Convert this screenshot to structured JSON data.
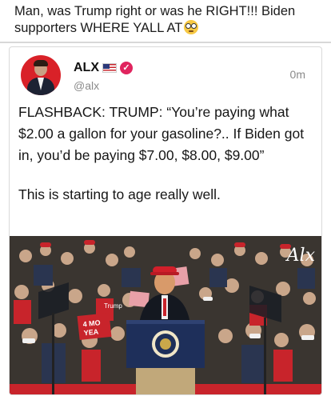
{
  "post": {
    "text": "Man, was Trump right or was he RIGHT!!! Biden supporters WHERE YALL AT",
    "emoji": "flushed-face-emoji"
  },
  "tweet": {
    "author_name": "ALX",
    "handle": "@alx",
    "time": "0m",
    "flag": "us-flag",
    "verified": "verified-badge",
    "paragraphs": [
      "FLASHBACK: TRUMP: “You’re paying what $2.00 a gallon for your gasoline?.. If Biden got in, you’d be paying $7.00, $8.00, $9.00”",
      "This is starting to age really well."
    ],
    "photo": {
      "watermark": "Alx",
      "sign_text": "4 MO\nYEA",
      "shirt_text": "Trump",
      "description_color_red": "#c8242b",
      "description_color_blue": "#1e2f5a"
    }
  }
}
